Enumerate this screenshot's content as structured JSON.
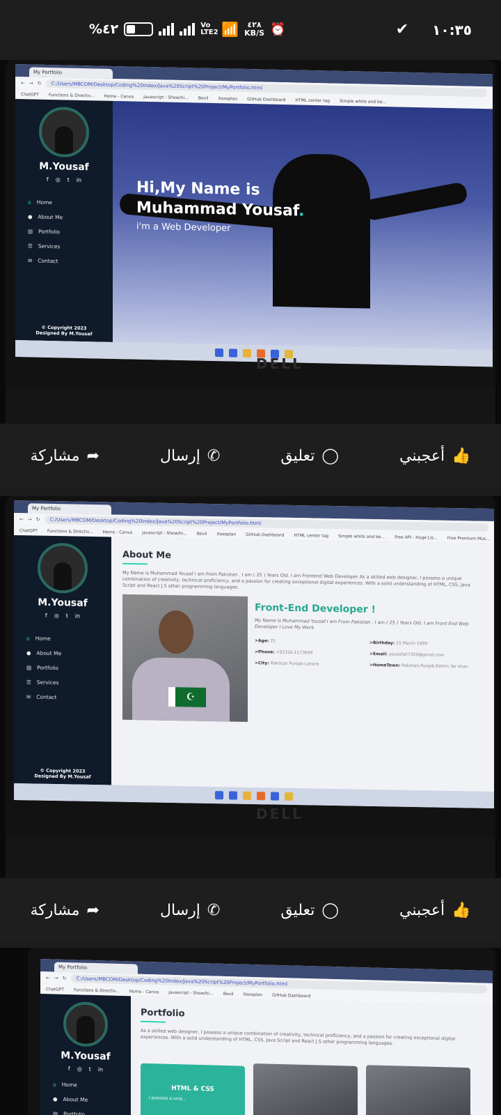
{
  "status_bar": {
    "battery": "%٤٢",
    "network_speed": "٤٢٨",
    "network_unit": "KB/S",
    "network_type": "Vo LTE2",
    "time": "١٠:٣٥"
  },
  "post_actions": {
    "like": "أعجبني",
    "comment": "تعليق",
    "send": "إرسال",
    "share": "مشاركة"
  },
  "browser": {
    "tab_title": "My Portfolio",
    "url": "C:/Users/MBCOM/Desktop/Coding%20Index/Java%20Script%20Project/MyPortfolio.html",
    "bookmarks": [
      "ChatGPT",
      "Functions & Directiv...",
      "Home - Canva",
      "javascript - Show/hi...",
      "Bevil",
      "Xoxoplan",
      "GitHub Dashboard",
      "HTML center tag",
      "Simple white and bo...",
      "Free API - Huge Lis...",
      "Free Premium Mus..."
    ]
  },
  "site": {
    "brand": "M.Yousaf",
    "nav": [
      "Home",
      "About Me",
      "Portfolio",
      "Services",
      "Contact"
    ],
    "copyright": "© Copyright 2023",
    "designed_by": "Designed By M.Yousaf",
    "hero_line1": "Hi,My Name is",
    "hero_name": "Muhammad Yousaf",
    "hero_dot": ".",
    "hero_sub": "i'm a Web Developer",
    "about_title": "About Me",
    "about_text": "My Name is Muhammad Yousaf I am From Pakistan . I am ( 25 ) Years Old. I am Frontend Web Developer As a skilled web designer, I possess a unique combination of creativity, technical proficiency, and a passion for creating exceptional digital experiences. With a solid understanding of HTML, CSS, Java Script and React J.S other programming languages.",
    "fe_title": "Front-End Developer !",
    "fe_text": "My Name is Muhammad Yousaf I am From Pakistan . I am ( 25 ) Years Old. I am Front End Web Developer I Love My Work",
    "details": {
      "age_label": ">Age:",
      "age": "25",
      "birthday_label": ">Birthday:",
      "birthday": "15 March 1999",
      "phone_label": ">Phone:",
      "phone": "+92316-1173649",
      "email_label": ">Email:",
      "email": "yousafali7359@gmail.com",
      "city_label": ">City:",
      "city": "Pakistan Punjab Lahore",
      "hometown_label": ">HomeTown:",
      "hometown": "Pakistan,Punjab,Rahim Yar khan"
    },
    "portfolio_title": "Portfolio",
    "portfolio_text": "As a skilled web designer, I possess a unique combination of creativity, technical proficiency, and a passion for creating exceptional digital experiences. With a solid understanding of HTML, CSS, Java Script and React J.S other programming languages.",
    "portfolio_card": "HTML & CSS",
    "portfolio_card_sub": "I possess a uniq..."
  },
  "laptop_brand": "DELL",
  "colors": {
    "accent": "#2ed3b7",
    "sidebar": "#0f1a2a"
  }
}
